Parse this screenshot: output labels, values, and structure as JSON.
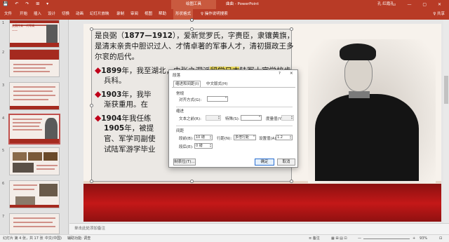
{
  "titlebar": {
    "quick_access": "💾 ↶ ↷ ⊞ ▾",
    "context_tab": "绘图工具",
    "document": "曲曲 - PowerPoint",
    "user": "孔 红霞孔",
    "window_buttons": "▭ — ▢ ✕"
  },
  "ribbon": {
    "tabs": [
      "文件",
      "开始",
      "插入",
      "设计",
      "切换",
      "动画",
      "幻灯片放映",
      "录制",
      "审阅",
      "视图",
      "帮助",
      "形状格式"
    ],
    "active_tab": "形状格式",
    "tell_me": "♀ 操作说明搜索",
    "share": "♀ 共享"
  },
  "slides_panel": {
    "numbers": [
      "1",
      "2",
      "3",
      "4",
      "5",
      "6",
      "7"
    ],
    "selected": "4",
    "slide1_text": "良弼传来一代军阀",
    "slide1_sub": "——"
  },
  "slide": {
    "p1_line1": "是良弼（",
    "p1_years": "1877—1912",
    "p1_line1b": "），爱新觉罗氏，字赉臣，隶镶黄旗，",
    "p1_line2": "是清末亲贵中胆识过人、才情卓著的军事人才，清初摄政王多",
    "p1_line3": "尔衮的后代。",
    "p2_year": "1899",
    "p2_text_a": "年，我至湖北，由张之洞派",
    "p2_highlight": "留学日本",
    "p2_text_b": "陆军士官学校步",
    "p2_line2": "兵科。",
    "p3_year": "1903",
    "p3_text": "年，我毕",
    "p3_line2": "渐获重用。在",
    "p4_year": "1904",
    "p4_text": "年我任练",
    "p4_line2_year": "1905",
    "p4_line2": "年，被提",
    "p4_line3": "官、军学司副使",
    "p4_line4": "试陆军游学毕业"
  },
  "dialog": {
    "title": "段落",
    "help": "?",
    "close": "✕",
    "tabs": [
      "缩进和间距(I)",
      "中文版式(H)"
    ],
    "section_general": "常规",
    "alignment_label": "对齐方式(G):",
    "alignment_value": "",
    "section_indent": "缩进",
    "before_text_label": "文本之前(R):",
    "before_text_value": "",
    "special_label": "特殊(S):",
    "special_value": "",
    "measure_label": "度量值(Y):",
    "measure_value": "",
    "section_spacing": "间距",
    "spacing_before_label": "段前(B):",
    "spacing_before_value": "10 磅",
    "line_spacing_label": "行距(N):",
    "line_spacing_value": "多倍行距",
    "set_value_label": "设置值(A)",
    "set_value": "1.2",
    "spacing_after_label": "段后(E):",
    "spacing_after_value": "0 磅",
    "tabs_button": "制表位(T)...",
    "ok": "确定",
    "cancel": "取消"
  },
  "notes": {
    "placeholder": "单击此处添加备注"
  },
  "status": {
    "slide_info": "幻灯片 第 4 张，共 17 张",
    "language": "中文(中国)",
    "accessibility": "辅助功能: 调查",
    "notes_btn": "≡ 备注",
    "views": "▦ ⊞ ▤ ⊡",
    "zoom_minus": "—",
    "zoom_plus": "+",
    "zoom": "93%",
    "fit": "⊡"
  },
  "colors": {
    "ribbon": "#b83b26",
    "slide_band": "#c41818",
    "bullet": "#c0001a",
    "highlight": "#f2e05a"
  }
}
